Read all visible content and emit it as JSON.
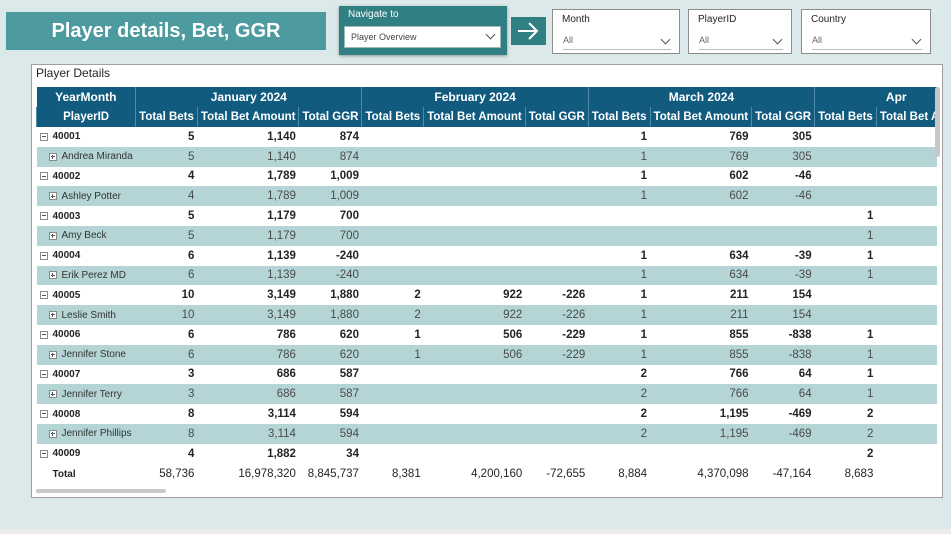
{
  "header": {
    "title": "Player details, Bet, GGR"
  },
  "navigate": {
    "label": "Navigate to",
    "value": "Player Overview"
  },
  "slicers": [
    {
      "label": "Month",
      "value": "All"
    },
    {
      "label": "PlayerID",
      "value": "All"
    },
    {
      "label": "Country",
      "value": "All"
    }
  ],
  "visual": {
    "title": "Player Details"
  },
  "table": {
    "corner_top": "YearMonth",
    "corner_bottom": "PlayerID",
    "months": [
      "January 2024",
      "February 2024",
      "March 2024",
      "Apr"
    ],
    "columns": [
      "Total Bets",
      "Total Bet Amount",
      "Total GGR"
    ],
    "rows": [
      {
        "type": "parent",
        "label": "40001",
        "jan": [
          "5",
          "1,140",
          "874"
        ],
        "feb": [
          "",
          "",
          ""
        ],
        "mar": [
          "1",
          "769",
          "305"
        ],
        "apr": ""
      },
      {
        "type": "child",
        "label": "Andrea Miranda",
        "jan": [
          "5",
          "1,140",
          "874"
        ],
        "feb": [
          "",
          "",
          ""
        ],
        "mar": [
          "1",
          "769",
          "305"
        ],
        "apr": ""
      },
      {
        "type": "parent",
        "label": "40002",
        "jan": [
          "4",
          "1,789",
          "1,009"
        ],
        "feb": [
          "",
          "",
          ""
        ],
        "mar": [
          "1",
          "602",
          "-46"
        ],
        "apr": ""
      },
      {
        "type": "child",
        "label": "Ashley Potter",
        "jan": [
          "4",
          "1,789",
          "1,009"
        ],
        "feb": [
          "",
          "",
          ""
        ],
        "mar": [
          "1",
          "602",
          "-46"
        ],
        "apr": ""
      },
      {
        "type": "parent",
        "label": "40003",
        "jan": [
          "5",
          "1,179",
          "700"
        ],
        "feb": [
          "",
          "",
          ""
        ],
        "mar": [
          "",
          "",
          ""
        ],
        "apr": "1"
      },
      {
        "type": "child",
        "label": "Amy Beck",
        "jan": [
          "5",
          "1,179",
          "700"
        ],
        "feb": [
          "",
          "",
          ""
        ],
        "mar": [
          "",
          "",
          ""
        ],
        "apr": "1"
      },
      {
        "type": "parent",
        "label": "40004",
        "jan": [
          "6",
          "1,139",
          "-240"
        ],
        "feb": [
          "",
          "",
          ""
        ],
        "mar": [
          "1",
          "634",
          "-39"
        ],
        "apr": "1"
      },
      {
        "type": "child",
        "label": "Erik Perez MD",
        "jan": [
          "6",
          "1,139",
          "-240"
        ],
        "feb": [
          "",
          "",
          ""
        ],
        "mar": [
          "1",
          "634",
          "-39"
        ],
        "apr": "1"
      },
      {
        "type": "parent",
        "label": "40005",
        "jan": [
          "10",
          "3,149",
          "1,880"
        ],
        "feb": [
          "2",
          "922",
          "-226"
        ],
        "mar": [
          "1",
          "211",
          "154"
        ],
        "apr": ""
      },
      {
        "type": "child",
        "label": "Leslie Smith",
        "jan": [
          "10",
          "3,149",
          "1,880"
        ],
        "feb": [
          "2",
          "922",
          "-226"
        ],
        "mar": [
          "1",
          "211",
          "154"
        ],
        "apr": ""
      },
      {
        "type": "parent",
        "label": "40006",
        "jan": [
          "6",
          "786",
          "620"
        ],
        "feb": [
          "1",
          "506",
          "-229"
        ],
        "mar": [
          "1",
          "855",
          "-838"
        ],
        "apr": "1"
      },
      {
        "type": "child",
        "label": "Jennifer Stone",
        "jan": [
          "6",
          "786",
          "620"
        ],
        "feb": [
          "1",
          "506",
          "-229"
        ],
        "mar": [
          "1",
          "855",
          "-838"
        ],
        "apr": "1"
      },
      {
        "type": "parent",
        "label": "40007",
        "jan": [
          "3",
          "686",
          "587"
        ],
        "feb": [
          "",
          "",
          ""
        ],
        "mar": [
          "2",
          "766",
          "64"
        ],
        "apr": "1"
      },
      {
        "type": "child",
        "label": "Jennifer Terry",
        "jan": [
          "3",
          "686",
          "587"
        ],
        "feb": [
          "",
          "",
          ""
        ],
        "mar": [
          "2",
          "766",
          "64"
        ],
        "apr": "1"
      },
      {
        "type": "parent",
        "label": "40008",
        "jan": [
          "8",
          "3,114",
          "594"
        ],
        "feb": [
          "",
          "",
          ""
        ],
        "mar": [
          "2",
          "1,195",
          "-469"
        ],
        "apr": "2"
      },
      {
        "type": "child",
        "label": "Jennifer Phillips",
        "jan": [
          "8",
          "3,114",
          "594"
        ],
        "feb": [
          "",
          "",
          ""
        ],
        "mar": [
          "2",
          "1,195",
          "-469"
        ],
        "apr": "2"
      },
      {
        "type": "parent",
        "label": "40009",
        "jan": [
          "4",
          "1,882",
          "34"
        ],
        "feb": [
          "",
          "",
          ""
        ],
        "mar": [
          "",
          "",
          ""
        ],
        "apr": "2"
      }
    ],
    "total": {
      "label": "Total",
      "jan": [
        "58,736",
        "16,978,320",
        "8,845,737"
      ],
      "feb": [
        "8,381",
        "4,200,160",
        "-72,655"
      ],
      "mar": [
        "8,884",
        "4,370,098",
        "-47,164"
      ],
      "apr": "8,683"
    }
  }
}
